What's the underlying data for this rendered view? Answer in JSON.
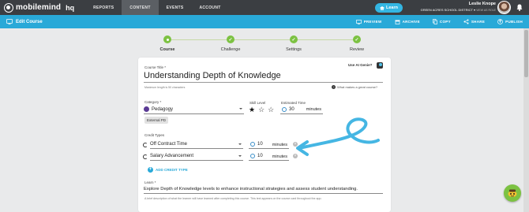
{
  "topnav": {
    "logo_text": "mobilemind",
    "logo_hq": "hq",
    "links": [
      {
        "label": "REPORTS",
        "active": false
      },
      {
        "label": "CONTENT",
        "active": true
      },
      {
        "label": "EVENTS",
        "active": false
      },
      {
        "label": "ACCOUNT",
        "active": false
      }
    ],
    "learn_button": "Learn",
    "user_name": "Leslie Knope",
    "district": "GREEN ACRES SCHOOL DISTRICT",
    "district_sub": "VIEW AS ROLE"
  },
  "coursebar": {
    "title": "Edit Course",
    "actions": [
      "PREVIEW",
      "ARCHIVE",
      "COPY",
      "SHARE",
      "PUBLISH"
    ]
  },
  "stepper": {
    "steps": [
      {
        "label": "Course",
        "state": "current"
      },
      {
        "label": "Challenge",
        "state": "done"
      },
      {
        "label": "Settings",
        "state": "done"
      },
      {
        "label": "Review",
        "state": "done"
      }
    ]
  },
  "form": {
    "title_label": "Course Title *",
    "use_ai_genie": "Use AI Genie?",
    "title_value": "Understanding Depth of Knowledge",
    "title_hint": "Maximum length is 50 characters",
    "great_course_link": "What makes a great course?",
    "category_label": "Category *",
    "category_value": "Pedagogy",
    "tag": "External PD",
    "skill_label": "Skill Level",
    "skill_level": 1,
    "skill_max": 3,
    "est_label": "Estimated Time",
    "est_value": "30",
    "minutes_label": "minutes",
    "credit_label": "Credit Types",
    "credits": [
      {
        "type": "Off Contract Time",
        "minutes": "10"
      },
      {
        "type": "Salary Advancement",
        "minutes": "10"
      }
    ],
    "add_credit": "ADD CREDIT TYPE",
    "learn_label": "Learn *",
    "learn_value": "Explore Depth of Knowledge levels to enhance instructional strategies and assess student understanding.",
    "learn_hint": "A brief description of what the learner will have learned after completing this course. This text appears on the course card throughout the app."
  },
  "colors": {
    "nav_bg": "#3b3e42",
    "accent_blue": "#29a9d8",
    "step_green": "#7cc242"
  }
}
